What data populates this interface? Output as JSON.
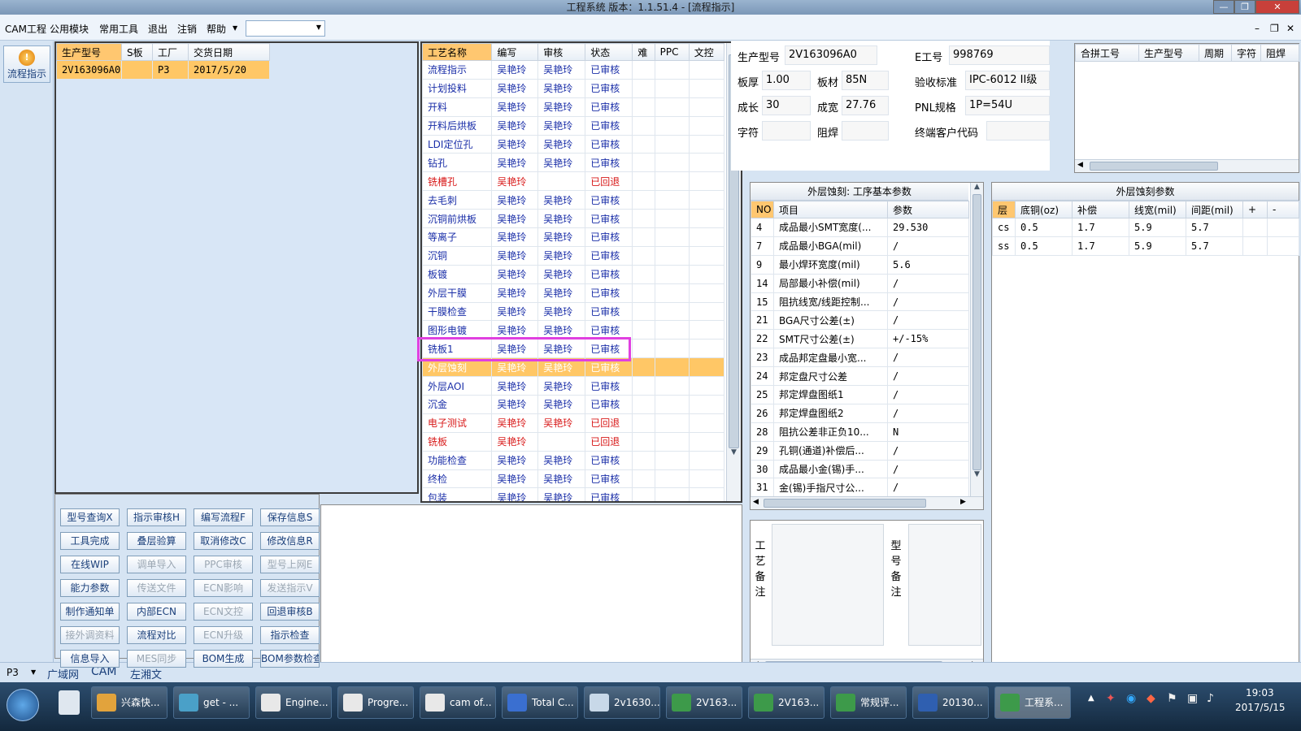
{
  "window": {
    "title": "工程系统 版本：1.1.51.4 - [流程指示]"
  },
  "menu": {
    "items": [
      "CAM工程",
      "公用模块",
      "常用工具",
      "退出",
      "注销",
      "帮助"
    ],
    "combo_value": ""
  },
  "toolbar": {
    "flow_button": "流程指示"
  },
  "orders": {
    "headers": [
      "生产型号",
      "S板",
      "工厂",
      "交货日期"
    ],
    "rows": [
      [
        "2V163096A0",
        "",
        "P3",
        "2017/5/20"
      ]
    ]
  },
  "process": {
    "headers": [
      "工艺名称",
      "编写",
      "审核",
      "状态",
      "难",
      "PPC",
      "文控"
    ],
    "rows": [
      {
        "name": "流程指示",
        "writer": "吴艳玲",
        "reviewer": "吴艳玲",
        "status": "已审核",
        "color": "blue"
      },
      {
        "name": "计划投料",
        "writer": "吴艳玲",
        "reviewer": "吴艳玲",
        "status": "已审核",
        "color": "blue"
      },
      {
        "name": "开料",
        "writer": "吴艳玲",
        "reviewer": "吴艳玲",
        "status": "已审核",
        "color": "blue"
      },
      {
        "name": "开料后烘板",
        "writer": "吴艳玲",
        "reviewer": "吴艳玲",
        "status": "已审核",
        "color": "blue"
      },
      {
        "name": "LDI定位孔",
        "writer": "吴艳玲",
        "reviewer": "吴艳玲",
        "status": "已审核",
        "color": "blue"
      },
      {
        "name": "钻孔",
        "writer": "吴艳玲",
        "reviewer": "吴艳玲",
        "status": "已审核",
        "color": "blue"
      },
      {
        "name": "铣槽孔",
        "writer": "吴艳玲",
        "reviewer": "",
        "status": "已回退",
        "color": "red"
      },
      {
        "name": "去毛刺",
        "writer": "吴艳玲",
        "reviewer": "吴艳玲",
        "status": "已审核",
        "color": "blue"
      },
      {
        "name": "沉铜前烘板",
        "writer": "吴艳玲",
        "reviewer": "吴艳玲",
        "status": "已审核",
        "color": "blue"
      },
      {
        "name": "等离子",
        "writer": "吴艳玲",
        "reviewer": "吴艳玲",
        "status": "已审核",
        "color": "blue"
      },
      {
        "name": "沉铜",
        "writer": "吴艳玲",
        "reviewer": "吴艳玲",
        "status": "已审核",
        "color": "blue"
      },
      {
        "name": "板镀",
        "writer": "吴艳玲",
        "reviewer": "吴艳玲",
        "status": "已审核",
        "color": "blue"
      },
      {
        "name": "外层干膜",
        "writer": "吴艳玲",
        "reviewer": "吴艳玲",
        "status": "已审核",
        "color": "blue"
      },
      {
        "name": "干膜检查",
        "writer": "吴艳玲",
        "reviewer": "吴艳玲",
        "status": "已审核",
        "color": "blue"
      },
      {
        "name": "图形电镀",
        "writer": "吴艳玲",
        "reviewer": "吴艳玲",
        "status": "已审核",
        "color": "blue"
      },
      {
        "name": "铣板1",
        "writer": "吴艳玲",
        "reviewer": "吴艳玲",
        "status": "已审核",
        "color": "blue"
      },
      {
        "name": "外层蚀刻",
        "writer": "吴艳玲",
        "reviewer": "吴艳玲",
        "status": "已审核",
        "color": "sel"
      },
      {
        "name": "外层AOI",
        "writer": "吴艳玲",
        "reviewer": "吴艳玲",
        "status": "已审核",
        "color": "blue"
      },
      {
        "name": "沉金",
        "writer": "吴艳玲",
        "reviewer": "吴艳玲",
        "status": "已审核",
        "color": "blue"
      },
      {
        "name": "电子测试",
        "writer": "吴艳玲",
        "reviewer": "吴艳玲",
        "status": "已回退",
        "color": "red"
      },
      {
        "name": "铣板",
        "writer": "吴艳玲",
        "reviewer": "",
        "status": "已回退",
        "color": "red"
      },
      {
        "name": "功能检查",
        "writer": "吴艳玲",
        "reviewer": "吴艳玲",
        "status": "已审核",
        "color": "blue"
      },
      {
        "name": "终检",
        "writer": "吴艳玲",
        "reviewer": "吴艳玲",
        "status": "已审核",
        "color": "blue"
      },
      {
        "name": "包装",
        "writer": "吴艳玲",
        "reviewer": "吴艳玲",
        "status": "已审核",
        "color": "blue"
      }
    ]
  },
  "buttons": [
    {
      "label": "型号查询X",
      "enabled": true
    },
    {
      "label": "指示审核H",
      "enabled": true
    },
    {
      "label": "编写流程F",
      "enabled": true
    },
    {
      "label": "保存信息S",
      "enabled": true
    },
    {
      "label": "工具完成",
      "enabled": true
    },
    {
      "label": "叠层验算",
      "enabled": true
    },
    {
      "label": "取消修改C",
      "enabled": true
    },
    {
      "label": "修改信息R",
      "enabled": true
    },
    {
      "label": "在线WIP",
      "enabled": true
    },
    {
      "label": "调单导入",
      "enabled": false
    },
    {
      "label": "PPC审核",
      "enabled": false
    },
    {
      "label": "型号上网E",
      "enabled": false
    },
    {
      "label": "能力参数",
      "enabled": true
    },
    {
      "label": "传送文件",
      "enabled": false
    },
    {
      "label": "ECN影响",
      "enabled": false
    },
    {
      "label": "发送指示V",
      "enabled": false
    },
    {
      "label": "制作通知单",
      "enabled": true
    },
    {
      "label": "内部ECN",
      "enabled": true
    },
    {
      "label": "ECN文控",
      "enabled": false
    },
    {
      "label": "回退审核B",
      "enabled": true
    },
    {
      "label": "接外调资料",
      "enabled": false
    },
    {
      "label": "流程对比",
      "enabled": true
    },
    {
      "label": "ECN升级",
      "enabled": false
    },
    {
      "label": "指示检查",
      "enabled": true
    },
    {
      "label": "信息导入",
      "enabled": true
    },
    {
      "label": "MES同步",
      "enabled": false
    },
    {
      "label": "BOM生成",
      "enabled": true
    },
    {
      "label": "BOM参数检查",
      "enabled": true
    }
  ],
  "info": {
    "prod_no_label": "生产型号",
    "prod_no": "2V163096A0",
    "e_no_label": "E工号",
    "e_no": "998769",
    "thickness_label": "板厚",
    "thickness": "1.00",
    "material_label": "板材",
    "material": "85N",
    "standard_label": "验收标准",
    "standard": "IPC-6012 II级",
    "length_label": "成长",
    "length": "30",
    "width_label": "成宽",
    "width": "27.76",
    "pnl_label": "PNL规格",
    "pnl": "1P=54U",
    "char_label": "字符",
    "char": "",
    "mask_label": "阻焊",
    "mask": "",
    "customer_label": "终端客户代码",
    "customer": ""
  },
  "merge": {
    "headers": [
      "合拼工号",
      "生产型号",
      "周期",
      "字符",
      "阻焊"
    ]
  },
  "params": {
    "title": "外层蚀刻: 工序基本参数",
    "headers": [
      "NO",
      "项目",
      "参数"
    ],
    "rows": [
      [
        "4",
        "成品最小SMT宽度(...",
        "29.530"
      ],
      [
        "7",
        "成品最小BGA(mil)",
        "/"
      ],
      [
        "9",
        "最小焊环宽度(mil)",
        "5.6"
      ],
      [
        "14",
        "局部最小补偿(mil)",
        "/"
      ],
      [
        "15",
        "阻抗线宽/线距控制...",
        "/"
      ],
      [
        "21",
        "BGA尺寸公差(±)",
        "/"
      ],
      [
        "22",
        "SMT尺寸公差(±)",
        "+/-15%"
      ],
      [
        "23",
        "成品邦定盘最小宽...",
        "/"
      ],
      [
        "24",
        "邦定盘尺寸公差",
        "/"
      ],
      [
        "25",
        "邦定焊盘图纸1",
        "/"
      ],
      [
        "26",
        "邦定焊盘图纸2",
        "/"
      ],
      [
        "28",
        "阻抗公差非正负10...",
        "N"
      ],
      [
        "29",
        "孔铜(通道)补偿后...",
        "/"
      ],
      [
        "30",
        "成品最小金(锡)手...",
        "/"
      ],
      [
        "31",
        "金(锡)手指尺寸公...",
        "/"
      ]
    ]
  },
  "etch": {
    "title": "外层蚀刻参数",
    "headers": [
      "层",
      "底铜(oz)",
      "补偿",
      "线宽(mil)",
      "间距(mil)",
      "+",
      "-"
    ],
    "rows": [
      [
        "cs",
        "0.5",
        "1.7",
        "5.9",
        "5.7",
        "",
        ""
      ],
      [
        "ss",
        "0.5",
        "1.7",
        "5.9",
        "5.7",
        "",
        ""
      ]
    ]
  },
  "remarks": {
    "process_label": "工艺备注",
    "model_label": "型号备注"
  },
  "status": {
    "factory": "P3",
    "links": [
      "广域网",
      "CAM",
      "左湘文"
    ]
  },
  "taskbar": {
    "items": [
      "兴森快...",
      "get - ...",
      "Engine...",
      "Progre...",
      "cam of...",
      "Total C...",
      "2v1630...",
      "2V163...",
      "2V163...",
      "常规评...",
      "20130...",
      "工程系..."
    ],
    "time": "19:03",
    "date": "2017/5/15"
  },
  "colors": {
    "selected_row": "#ffc766",
    "review_ok": "#1a2ea8",
    "reverted": "#d81919",
    "highlight_box": "#e040e0"
  }
}
